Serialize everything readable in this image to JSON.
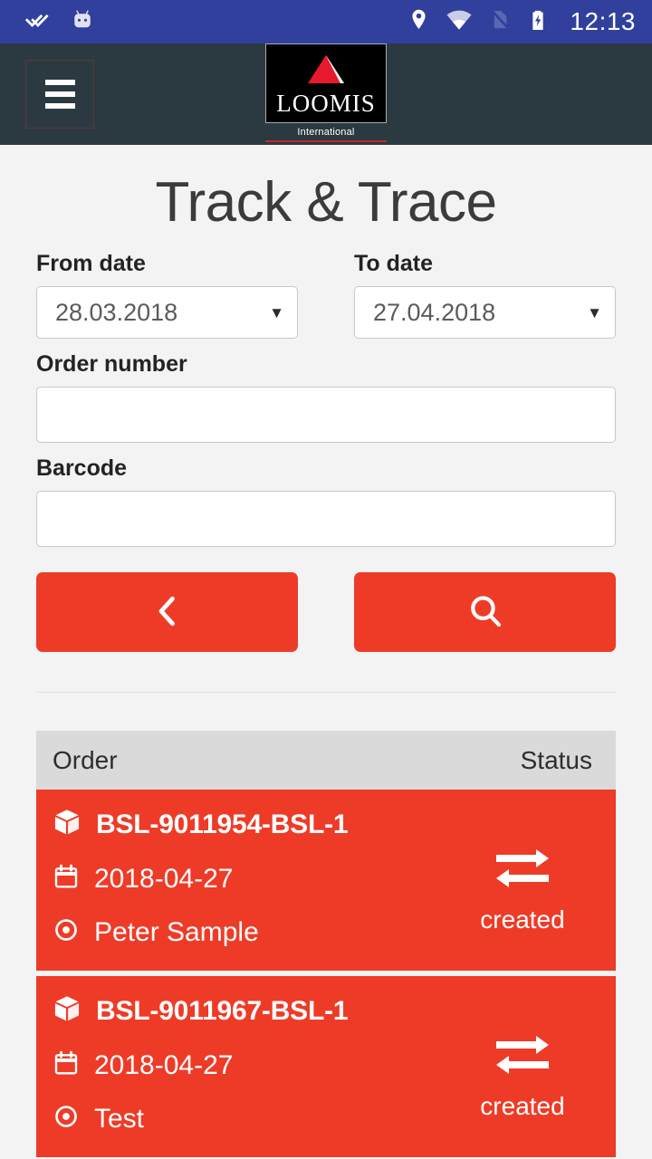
{
  "status_bar": {
    "notifications": [
      "double-check-icon",
      "android-robot-icon"
    ],
    "indicators": [
      "location-pin-icon",
      "wifi-icon",
      "no-sim-icon",
      "battery-charging-icon"
    ],
    "clock": "12:13"
  },
  "header": {
    "menu_icon": "hamburger-menu-icon",
    "logo": {
      "word": "LOOMIS",
      "subtitle": "International"
    }
  },
  "page": {
    "title": "Track & Trace"
  },
  "form": {
    "from_date": {
      "label": "From date",
      "value": "28.03.2018"
    },
    "to_date": {
      "label": "To date",
      "value": "27.04.2018"
    },
    "order_number": {
      "label": "Order number",
      "value": "",
      "placeholder": ""
    },
    "barcode": {
      "label": "Barcode",
      "value": "",
      "placeholder": ""
    },
    "buttons": [
      {
        "name": "back-button",
        "icon": "chevron-left-icon"
      },
      {
        "name": "search-button",
        "icon": "magnifier-icon"
      }
    ]
  },
  "results": {
    "columns": [
      "Order",
      "Status"
    ],
    "rows": [
      {
        "order": "BSL-9011954-BSL-1",
        "date": "2018-04-27",
        "contact": "Peter Sample",
        "status": "created",
        "status_icon": "exchange-arrows-icon"
      },
      {
        "order": "BSL-9011967-BSL-1",
        "date": "2018-04-27",
        "contact": "Test",
        "status": "created",
        "status_icon": "exchange-arrows-icon"
      }
    ]
  },
  "colors": {
    "status_bar": "#31409C",
    "app_bar": "#2B3A41",
    "accent_red": "#EE3B27",
    "page_background": "#F2F3F2",
    "table_header": "#DADADA",
    "logo_rule": "#C1272D"
  }
}
